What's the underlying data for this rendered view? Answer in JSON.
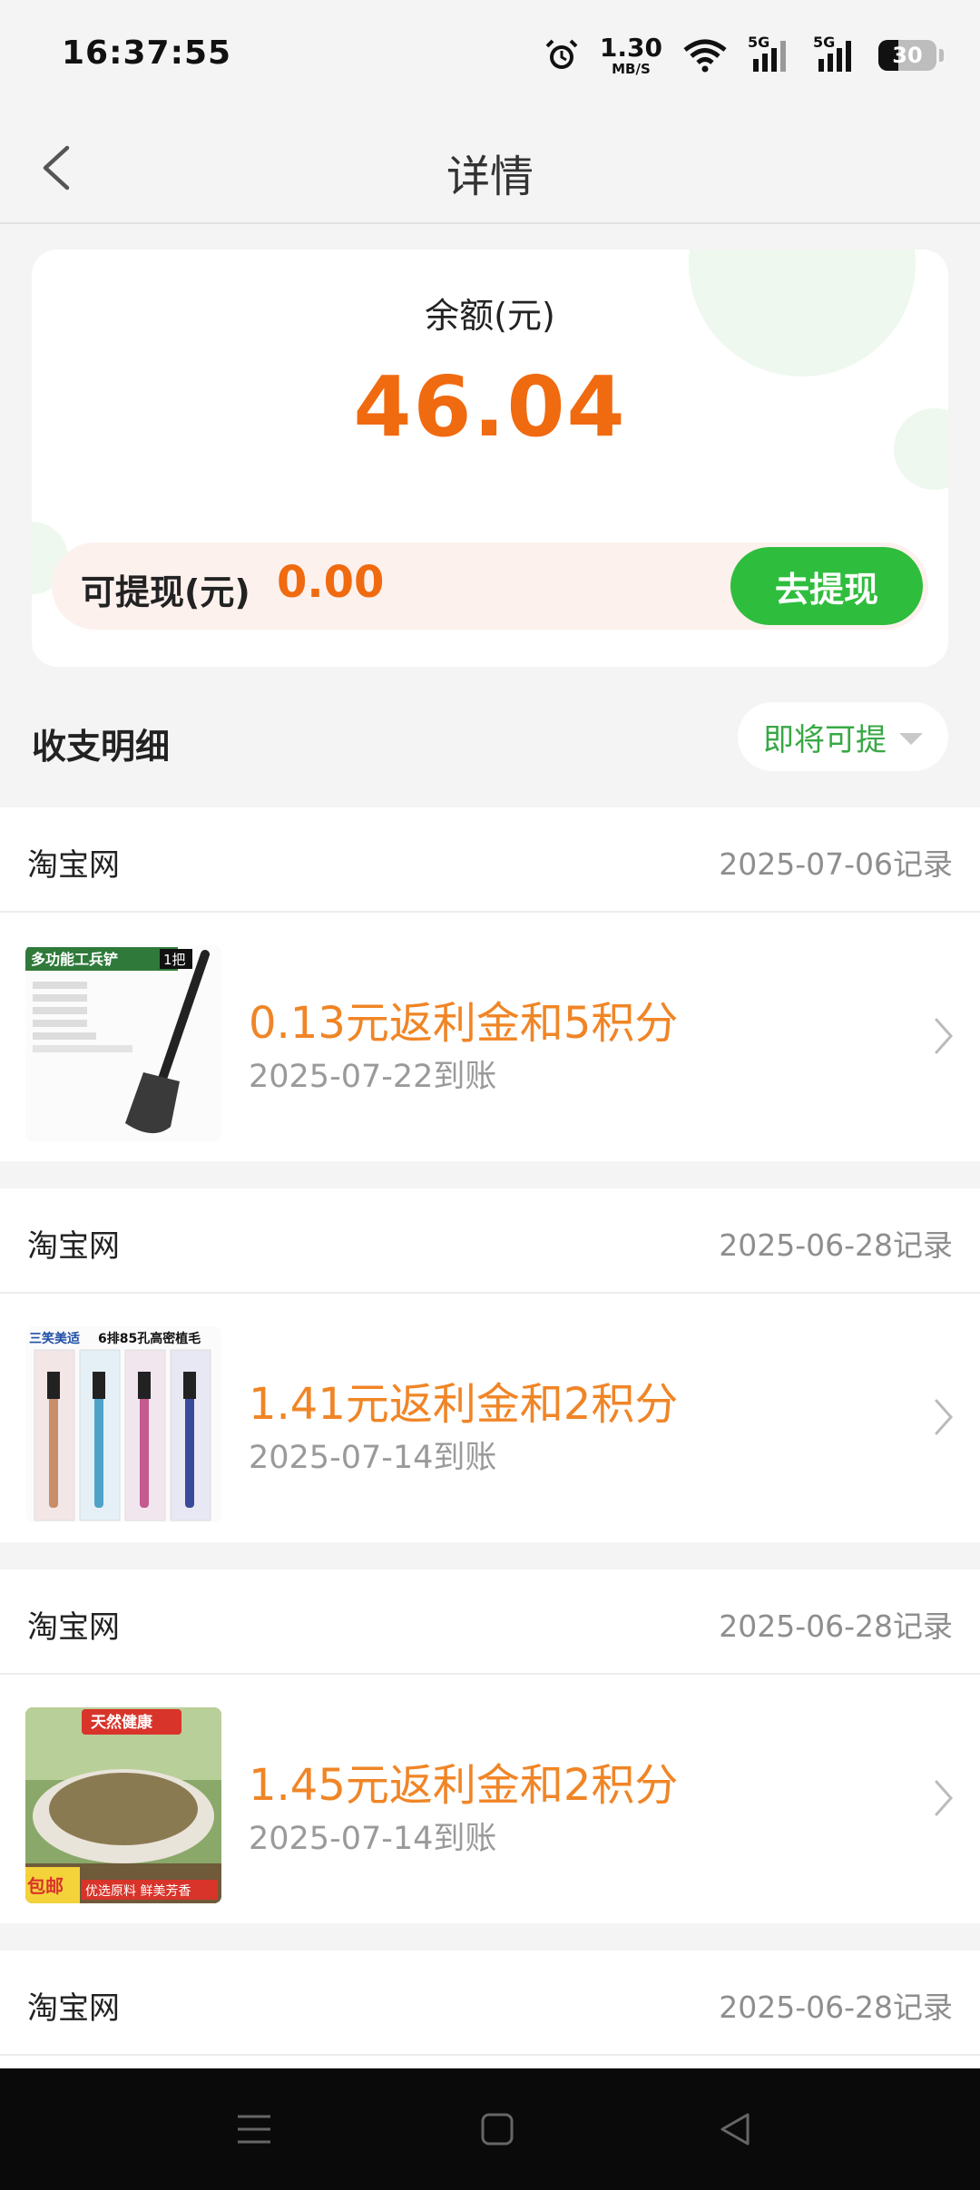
{
  "status_bar": {
    "time": "16:37:55",
    "net_speed_value": "1.30",
    "net_speed_unit": "MB/S",
    "signal1_label": "5G",
    "signal2_label": "5G",
    "battery_level": "30",
    "icons": [
      "alarm-icon",
      "wifi-icon",
      "signal-icon",
      "signal-icon",
      "battery-icon"
    ]
  },
  "nav": {
    "title": "详情"
  },
  "balance": {
    "label": "余额(元)",
    "amount": "46.04",
    "withdrawable_label": "可提现(元)",
    "withdrawable_amount": "0.00",
    "withdraw_button": "去提现"
  },
  "details": {
    "title": "收支明细",
    "filter_label": "即将可提"
  },
  "records": [
    {
      "store": "淘宝网",
      "recorded": "2025-07-06记录",
      "reward": "0.13元返利金和5积分",
      "arrival": "2025-07-22到账",
      "thumb_text": [
        "多功能工兵铲",
        "1把"
      ]
    },
    {
      "store": "淘宝网",
      "recorded": "2025-06-28记录",
      "reward": "1.41元返利金和2积分",
      "arrival": "2025-07-14到账",
      "thumb_text": [
        "三笑美适",
        "6排85孔高密植毛"
      ]
    },
    {
      "store": "淘宝网",
      "recorded": "2025-06-28记录",
      "reward": "1.45元返利金和2积分",
      "arrival": "2025-07-14到账",
      "thumb_text": [
        "天然健康",
        "包邮",
        "优选原料 鲜美芳香"
      ]
    },
    {
      "store": "淘宝网",
      "recorded": "2025-06-28记录"
    }
  ],
  "colors": {
    "accent_orange": "#f06a10",
    "reward_orange": "#f08526",
    "green": "#2fbd3e",
    "filter_green": "#38a845",
    "background": "#f4f4f4"
  }
}
